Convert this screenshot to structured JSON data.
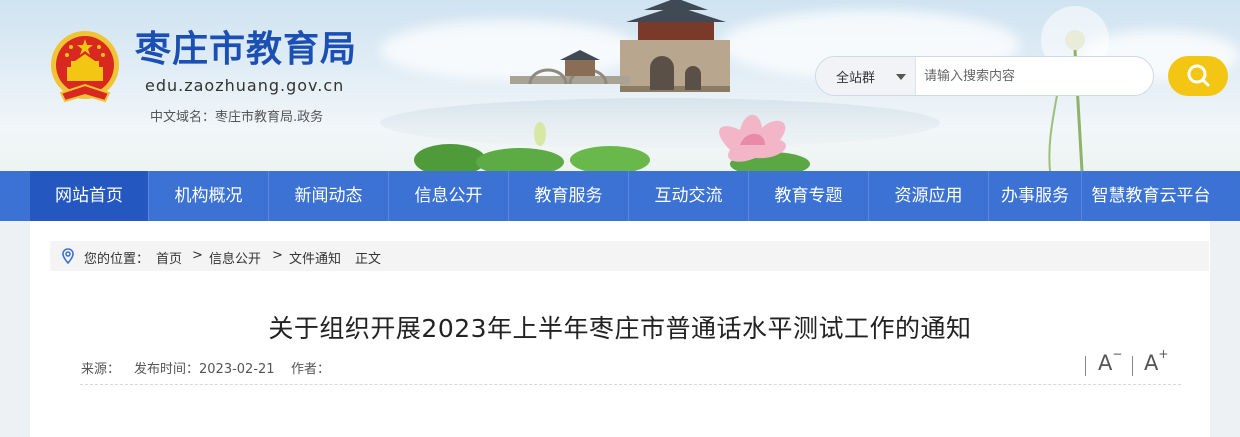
{
  "header": {
    "site_title": "枣庄市教育局",
    "site_domain": "edu.zaozhuang.gov.cn",
    "cn_domain": "中文域名：枣庄市教育局.政务",
    "emblem_icon": "national-emblem-icon"
  },
  "search": {
    "scope_label": "全站群",
    "placeholder": "请输入搜索内容",
    "button_icon": "search-icon"
  },
  "nav": {
    "items": [
      {
        "label": "网站首页"
      },
      {
        "label": "机构概况"
      },
      {
        "label": "新闻动态"
      },
      {
        "label": "信息公开"
      },
      {
        "label": "教育服务"
      },
      {
        "label": "互动交流"
      },
      {
        "label": "教育专题"
      },
      {
        "label": "资源应用"
      },
      {
        "label": "办事服务"
      },
      {
        "label": "智慧教育云平台"
      }
    ]
  },
  "breadcrumb": {
    "location_icon": "location-pin-icon",
    "prefix": "您的位置：",
    "items": [
      "首页",
      "信息公开",
      "文件通知",
      "正文"
    ],
    "separator": ">"
  },
  "article": {
    "title": "关于组织开展2023年上半年枣庄市普通话水平测试工作的通知",
    "source_label": "来源：",
    "date_label": "发布时间：2023-02-21",
    "author_label": "作者："
  },
  "font_controls": {
    "decrease_label": "A",
    "decrease_mark": "−",
    "increase_label": "A",
    "increase_mark": "+"
  },
  "colors": {
    "nav_bg": "#3b72d3",
    "nav_active": "#2457bf",
    "title_blue": "#1c4fb3",
    "search_button": "#f3c613"
  }
}
